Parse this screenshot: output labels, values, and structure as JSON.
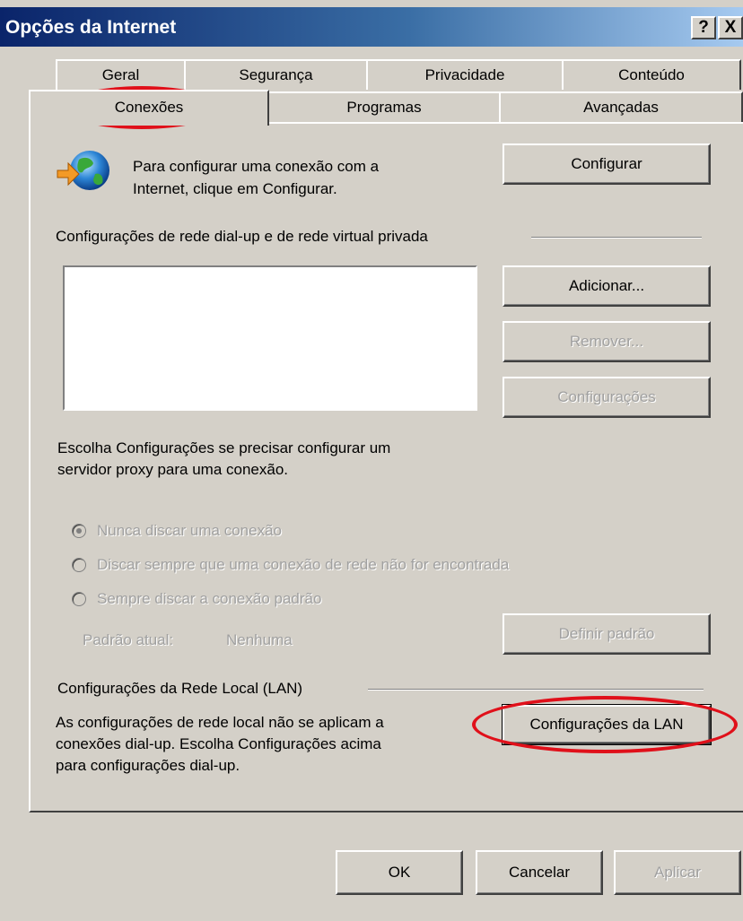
{
  "window": {
    "title": "Opções da Internet",
    "help_btn": "?",
    "close_btn": "X"
  },
  "tabs": {
    "row1": [
      "Geral",
      "Segurança",
      "Privacidade",
      "Conteúdo"
    ],
    "row2": [
      "Conexões",
      "Programas",
      "Avançadas"
    ],
    "active": "Conexões"
  },
  "setup": {
    "text_line1": "Para configurar uma conexão com a",
    "text_line2": "Internet, clique em Configurar.",
    "button": "Configurar",
    "icon": "globe-arrow-icon"
  },
  "dialup": {
    "group_label": "Configurações de rede dial-up e de rede virtual privada",
    "add_button": "Adicionar...",
    "remove_button": "Remover...",
    "settings_button": "Configurações",
    "proxy_hint_line1": "Escolha Configurações se precisar configurar um",
    "proxy_hint_line2": "servidor proxy para uma conexão.",
    "radio_never": "Nunca discar uma conexão",
    "radio_when_no_network": "Discar sempre que uma conexão de rede não for encontrada",
    "radio_always": "Sempre discar a conexão padrão",
    "current_label": "Padrão atual:",
    "current_value": "Nenhuma",
    "set_default_button": "Definir padrão"
  },
  "lan": {
    "group_label": "Configurações da Rede Local (LAN)",
    "text_line1": "As configurações de rede local não se aplicam a",
    "text_line2": "conexões dial-up. Escolha Configurações acima",
    "text_line3": "para configurações dial-up.",
    "button": "Configurações da LAN"
  },
  "footer": {
    "ok": "OK",
    "cancel": "Cancelar",
    "apply": "Aplicar"
  },
  "colors": {
    "highlight": "#e0101a",
    "titlebar_start": "#0a246a",
    "titlebar_end": "#a6caf0",
    "face": "#d4d0c8"
  }
}
